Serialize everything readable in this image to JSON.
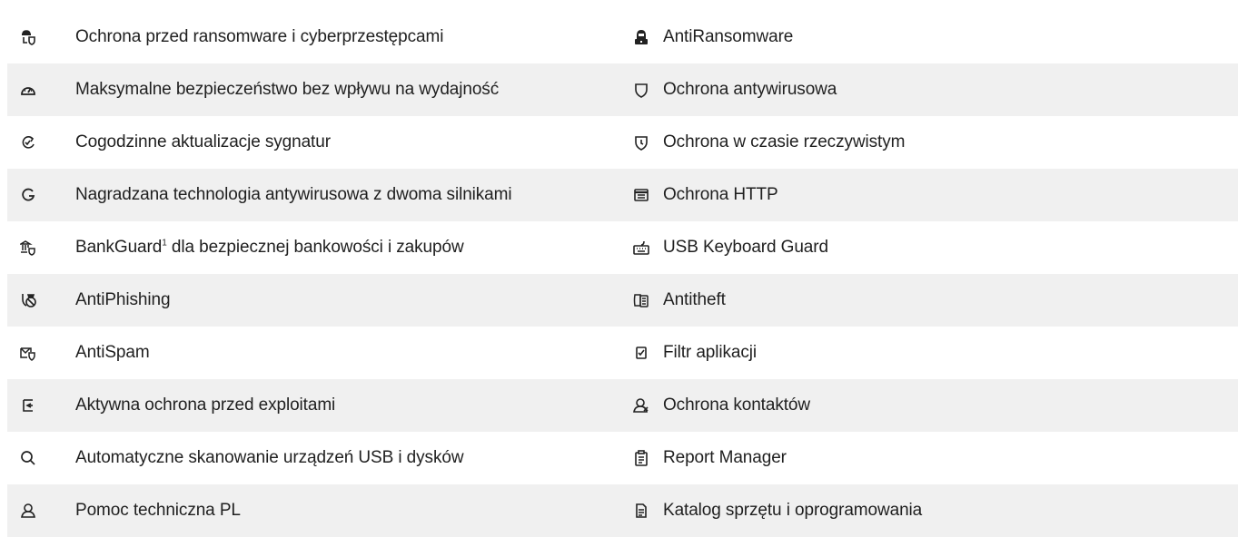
{
  "rows": [
    {
      "left": {
        "icon": "hacker-shield-icon",
        "label": "Ochrona przed ransomware i cyberprzestępcami"
      },
      "right": {
        "icon": "hooded-user-lock-icon",
        "label": "AntiRansomware"
      }
    },
    {
      "left": {
        "icon": "speedometer-icon",
        "label": "Maksymalne bezpieczeństwo bez wpływu na wydajność"
      },
      "right": {
        "icon": "shield-icon",
        "label": "Ochrona antywirusowa"
      }
    },
    {
      "left": {
        "icon": "refresh-check-icon",
        "label": "Cogodzinne aktualizacje sygnatur"
      },
      "right": {
        "icon": "shield-clock-icon",
        "label": "Ochrona w czasie rzeczywistym"
      }
    },
    {
      "left": {
        "icon": "g-logo-icon",
        "label": "Nagradzana technologia antywirusowa z dwoma silnikami"
      },
      "right": {
        "icon": "browser-window-icon",
        "label": "Ochrona HTTP"
      }
    },
    {
      "left": {
        "icon": "bank-shield-icon",
        "label_main": "BankGuard",
        "label_sup": "1",
        "label_rest": " dla bezpiecznej bankowości i zakupów"
      },
      "right": {
        "icon": "keyboard-icon",
        "label": "USB Keyboard Guard"
      }
    },
    {
      "left": {
        "icon": "phishing-hook-icon",
        "label": "AntiPhishing"
      },
      "right": {
        "icon": "device-shield-icon",
        "label": "Antitheft"
      }
    },
    {
      "left": {
        "icon": "mail-shield-icon",
        "label": "AntiSpam"
      },
      "right": {
        "icon": "checkbox-icon",
        "label": "Filtr aplikacji"
      }
    },
    {
      "left": {
        "icon": "exploit-block-icon",
        "label": "Aktywna ochrona przed exploitami"
      },
      "right": {
        "icon": "contacts-icon",
        "label": "Ochrona kontaktów"
      }
    },
    {
      "left": {
        "icon": "search-icon",
        "label": "Automatyczne skanowanie urządzeń USB i dysków"
      },
      "right": {
        "icon": "clipboard-icon",
        "label": "Report Manager"
      }
    },
    {
      "left": {
        "icon": "support-user-icon",
        "label": "Pomoc techniczna PL"
      },
      "right": {
        "icon": "document-icon",
        "label": "Katalog sprzętu i oprogramowania"
      }
    }
  ],
  "colors": {
    "row_shade": "#f0f0f0",
    "text": "#1f1f1f",
    "icon": "#222222"
  }
}
